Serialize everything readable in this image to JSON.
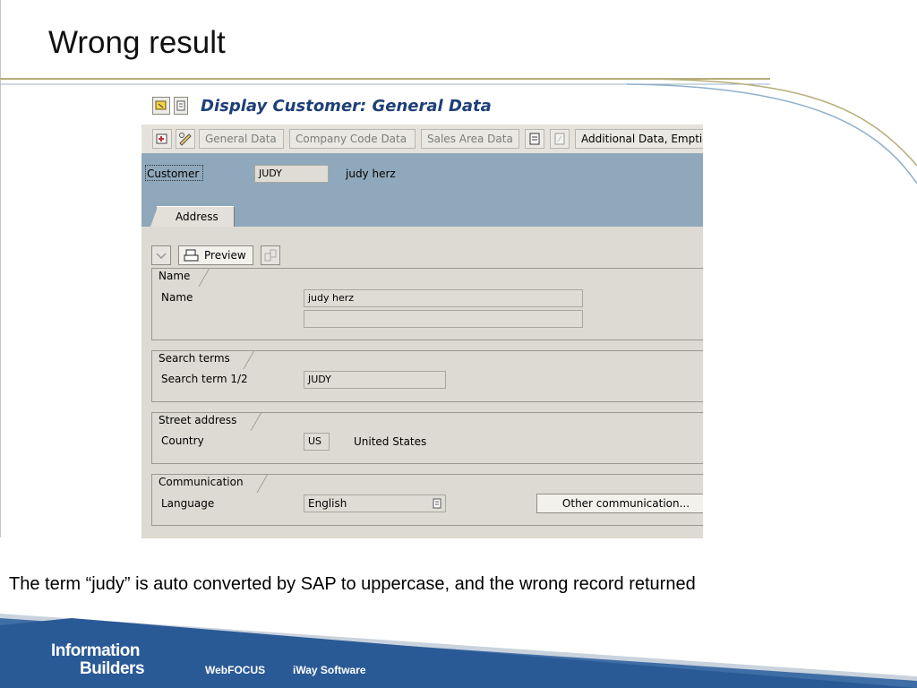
{
  "slide": {
    "title": "Wrong result",
    "caption": "The term “judy” is auto converted by SAP to uppercase, and the wrong record returned"
  },
  "sap": {
    "window_title": "Display Customer: General Data",
    "toolbar": {
      "general_data": "General Data",
      "company_code_data": "Company Code Data",
      "sales_area_data": "Sales Area Data",
      "additional_data": "Additional Data, Empties"
    },
    "header": {
      "customer_label": "Customer",
      "customer_value": "JUDY",
      "customer_name": "judy herz"
    },
    "tabs": [
      {
        "label": "Address"
      }
    ],
    "actions": {
      "preview_label": "Preview"
    },
    "groups": {
      "name": {
        "title": "Name",
        "name_label": "Name",
        "name_value": "judy herz",
        "name2_value": ""
      },
      "search_terms": {
        "title": "Search terms",
        "label": "Search term 1/2",
        "value": "JUDY"
      },
      "street_address": {
        "title": "Street address",
        "country_label": "Country",
        "country_code": "US",
        "country_name": "United States"
      },
      "communication": {
        "title": "Communication",
        "language_label": "Language",
        "language_value": "English",
        "other_button": "Other communication..."
      }
    }
  },
  "footer": {
    "logo_line1": "Information",
    "logo_line2": "Builders",
    "product1": "WebFOCUS",
    "product2": "iWay Software"
  },
  "colors": {
    "sap_title": "#1e3f78",
    "header_band": "#8fa8bb",
    "footer_blue": "#3f6da6"
  }
}
